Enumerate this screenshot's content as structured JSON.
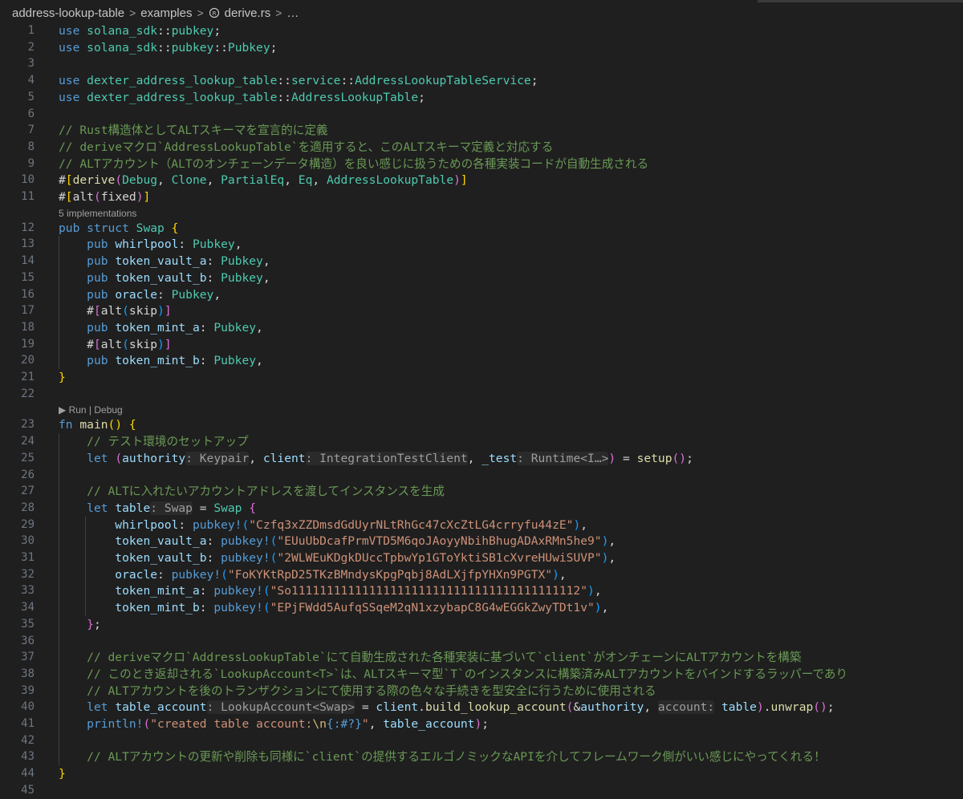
{
  "breadcrumb": {
    "items": [
      "address-lookup-table",
      "examples",
      "derive.rs",
      "…"
    ]
  },
  "code_lens": {
    "implementations": "5 implementations",
    "run_debug": "▶ Run | Debug"
  },
  "lines": [
    {
      "n": "1",
      "html": "<span class=\"kw\">use</span> <span class=\"mod\">solana_sdk</span><span class=\"punc\">::</span><span class=\"mod\">pubkey</span><span class=\"punc\">;</span>"
    },
    {
      "n": "2",
      "html": "<span class=\"kw\">use</span> <span class=\"mod\">solana_sdk</span><span class=\"punc\">::</span><span class=\"mod\">pubkey</span><span class=\"punc\">::</span><span class=\"ty\">Pubkey</span><span class=\"punc\">;</span>"
    },
    {
      "n": "3",
      "html": ""
    },
    {
      "n": "4",
      "html": "<span class=\"kw\">use</span> <span class=\"mod\">dexter_address_lookup_table</span><span class=\"punc\">::</span><span class=\"mod\">service</span><span class=\"punc\">::</span><span class=\"ty\">AddressLookupTableService</span><span class=\"punc\">;</span>"
    },
    {
      "n": "5",
      "html": "<span class=\"kw\">use</span> <span class=\"mod\">dexter_address_lookup_table</span><span class=\"punc\">::</span><span class=\"ty\">AddressLookupTable</span><span class=\"punc\">;</span>"
    },
    {
      "n": "6",
      "html": ""
    },
    {
      "n": "7",
      "html": "<span class=\"cm\">// Rust構造体としてALTスキーマを宣言的に定義</span>"
    },
    {
      "n": "8",
      "html": "<span class=\"cm\">// deriveマクロ`AddressLookupTable`を適用すると、このALTスキーマ定義と対応する</span>"
    },
    {
      "n": "9",
      "html": "<span class=\"cm\">// ALTアカウント（ALTのオンチェーンデータ構造）を良い感じに扱うための各種実装コードが自動生成される</span>"
    },
    {
      "n": "10",
      "html": "<span class=\"punc\">#</span><span class=\"p1\">[</span><span class=\"fn\">derive</span><span class=\"p2\">(</span><span class=\"ty\">Debug</span><span class=\"punc\">, </span><span class=\"ty\">Clone</span><span class=\"punc\">, </span><span class=\"ty\">PartialEq</span><span class=\"punc\">, </span><span class=\"ty\">Eq</span><span class=\"punc\">, </span><span class=\"ty\">AddressLookupTable</span><span class=\"p2\">)</span><span class=\"p1\">]</span>"
    },
    {
      "n": "11",
      "html": "<span class=\"punc\">#</span><span class=\"p1\">[</span><span class=\"punc\">alt</span><span class=\"p2\">(</span><span class=\"punc\">fixed</span><span class=\"p2\">)</span><span class=\"p1\">]</span>"
    },
    {
      "n": "12",
      "html": "<span class=\"kw\">pub</span> <span class=\"kw\">struct</span> <span class=\"ty\">Swap</span> <span class=\"p1\">{</span>"
    },
    {
      "n": "13",
      "html": "    <span class=\"kw\">pub</span> <span class=\"var\">whirlpool</span><span class=\"punc\">: </span><span class=\"ty\">Pubkey</span><span class=\"punc\">,</span>"
    },
    {
      "n": "14",
      "html": "    <span class=\"kw\">pub</span> <span class=\"var\">token_vault_a</span><span class=\"punc\">: </span><span class=\"ty\">Pubkey</span><span class=\"punc\">,</span>"
    },
    {
      "n": "15",
      "html": "    <span class=\"kw\">pub</span> <span class=\"var\">token_vault_b</span><span class=\"punc\">: </span><span class=\"ty\">Pubkey</span><span class=\"punc\">,</span>"
    },
    {
      "n": "16",
      "html": "    <span class=\"kw\">pub</span> <span class=\"var\">oracle</span><span class=\"punc\">: </span><span class=\"ty\">Pubkey</span><span class=\"punc\">,</span>"
    },
    {
      "n": "17",
      "html": "    <span class=\"punc\">#</span><span class=\"p2\">[</span><span class=\"punc\">alt</span><span class=\"p3\">(</span><span class=\"punc\">skip</span><span class=\"p3\">)</span><span class=\"p2\">]</span>"
    },
    {
      "n": "18",
      "html": "    <span class=\"kw\">pub</span> <span class=\"var\">token_mint_a</span><span class=\"punc\">: </span><span class=\"ty\">Pubkey</span><span class=\"punc\">,</span>"
    },
    {
      "n": "19",
      "html": "    <span class=\"punc\">#</span><span class=\"p2\">[</span><span class=\"punc\">alt</span><span class=\"p3\">(</span><span class=\"punc\">skip</span><span class=\"p3\">)</span><span class=\"p2\">]</span>"
    },
    {
      "n": "20",
      "html": "    <span class=\"kw\">pub</span> <span class=\"var\">token_mint_b</span><span class=\"punc\">: </span><span class=\"ty\">Pubkey</span><span class=\"punc\">,</span>"
    },
    {
      "n": "21",
      "html": "<span class=\"p1\">}</span>"
    },
    {
      "n": "22",
      "html": ""
    },
    {
      "n": "23",
      "html": "<span class=\"kw\">fn</span> <span class=\"fn\">main</span><span class=\"p1\">()</span> <span class=\"p1\">{</span>"
    },
    {
      "n": "24",
      "html": "    <span class=\"cm\">// テスト環境のセットアップ</span>"
    },
    {
      "n": "25",
      "html": "    <span class=\"kw\">let</span> <span class=\"p2\">(</span><span class=\"var\">authority</span><span class=\"hint\">: Keypair</span><span class=\"punc\">, </span><span class=\"var\">client</span><span class=\"hint\">: IntegrationTestClient</span><span class=\"punc\">, </span><span class=\"var\">_test</span><span class=\"hint\">: Runtime&lt;I…&gt;</span><span class=\"p2\">)</span><span class=\"punc\"> = </span><span class=\"fn\">setup</span><span class=\"p2\">()</span><span class=\"punc\">;</span>"
    },
    {
      "n": "26",
      "html": ""
    },
    {
      "n": "27",
      "html": "    <span class=\"cm\">// ALTに入れたいアカウントアドレスを渡してインスタンスを生成</span>"
    },
    {
      "n": "28",
      "html": "    <span class=\"kw\">let</span> <span class=\"var\">table</span><span class=\"hint\">: Swap</span><span class=\"punc\"> = </span><span class=\"ty\">Swap</span> <span class=\"p2\">{</span>"
    },
    {
      "n": "29",
      "html": "        <span class=\"var\">whirlpool</span><span class=\"punc\">: </span><span class=\"mac\">pubkey!</span><span class=\"p3\">(</span><span class=\"str\">\"Czfq3xZZDmsdGdUyrNLtRhGc47cXcZtLG4crryfu44zE\"</span><span class=\"p3\">)</span><span class=\"punc\">,</span>"
    },
    {
      "n": "30",
      "html": "        <span class=\"var\">token_vault_a</span><span class=\"punc\">: </span><span class=\"mac\">pubkey!</span><span class=\"p3\">(</span><span class=\"str\">\"EUuUbDcafPrmVTD5M6qoJAoyyNbihBhugADAxRMn5he9\"</span><span class=\"p3\">)</span><span class=\"punc\">,</span>"
    },
    {
      "n": "31",
      "html": "        <span class=\"var\">token_vault_b</span><span class=\"punc\">: </span><span class=\"mac\">pubkey!</span><span class=\"p3\">(</span><span class=\"str\">\"2WLWEuKDgkDUccTpbwYp1GToYktiSB1cXvreHUwiSUVP\"</span><span class=\"p3\">)</span><span class=\"punc\">,</span>"
    },
    {
      "n": "32",
      "html": "        <span class=\"var\">oracle</span><span class=\"punc\">: </span><span class=\"mac\">pubkey!</span><span class=\"p3\">(</span><span class=\"str\">\"FoKYKtRpD25TKzBMndysKpgPqbj8AdLXjfpYHXn9PGTX\"</span><span class=\"p3\">)</span><span class=\"punc\">,</span>"
    },
    {
      "n": "33",
      "html": "        <span class=\"var\">token_mint_a</span><span class=\"punc\">: </span><span class=\"mac\">pubkey!</span><span class=\"p3\">(</span><span class=\"str\">\"So11111111111111111111111111111111111111112\"</span><span class=\"p3\">)</span><span class=\"punc\">,</span>"
    },
    {
      "n": "34",
      "html": "        <span class=\"var\">token_mint_b</span><span class=\"punc\">: </span><span class=\"mac\">pubkey!</span><span class=\"p3\">(</span><span class=\"str\">\"EPjFWdd5AufqSSqeM2qN1xzybapC8G4wEGGkZwyTDt1v\"</span><span class=\"p3\">)</span><span class=\"punc\">,</span>"
    },
    {
      "n": "35",
      "html": "    <span class=\"p2\">}</span><span class=\"punc\">;</span>"
    },
    {
      "n": "36",
      "html": ""
    },
    {
      "n": "37",
      "html": "    <span class=\"cm\">// deriveマクロ`AddressLookupTable`にて自動生成された各種実装に基づいて`client`がオンチェーンにALTアカウントを構築</span>"
    },
    {
      "n": "38",
      "html": "    <span class=\"cm\">// このとき返却される`LookupAccount&lt;T&gt;`は、ALTスキーマ型`T`のインスタンスに構築済みALTアカウントをバインドするラッパーであり</span>"
    },
    {
      "n": "39",
      "html": "    <span class=\"cm\">// ALTアカウントを後のトランザクションにて使用する際の色々な手続きを型安全に行うために使用される</span>"
    },
    {
      "n": "40",
      "html": "    <span class=\"kw\">let</span> <span class=\"var\">table_account</span><span class=\"hint\">: LookupAccount&lt;Swap&gt;</span><span class=\"punc\"> = </span><span class=\"var\">client</span><span class=\"punc\">.</span><span class=\"fn\">build_lookup_account</span><span class=\"p2\">(</span><span class=\"punc\">&amp;</span><span class=\"var\">authority</span><span class=\"punc\">, </span><span class=\"hint\">account:</span> <span class=\"var\">table</span><span class=\"p2\">)</span><span class=\"punc\">.</span><span class=\"fn\">unwrap</span><span class=\"p2\">()</span><span class=\"punc\">;</span>"
    },
    {
      "n": "41",
      "html": "    <span class=\"mac\">println!</span><span class=\"p2\">(</span><span class=\"str\">\"created table account:</span><span class=\"esc\">\\n</span><span class=\"kw\">{:#?}</span><span class=\"str\">\"</span><span class=\"punc\">, </span><span class=\"var\">table_account</span><span class=\"p2\">)</span><span class=\"punc\">;</span>"
    },
    {
      "n": "42",
      "html": ""
    },
    {
      "n": "43",
      "html": "    <span class=\"cm\">// ALTアカウントの更新や削除も同様に`client`の提供するエルゴノミックなAPIを介してフレームワーク側がいい感じにやってくれる！</span>"
    },
    {
      "n": "44",
      "html": "<span class=\"p1\">}</span>"
    },
    {
      "n": "45",
      "html": ""
    }
  ]
}
